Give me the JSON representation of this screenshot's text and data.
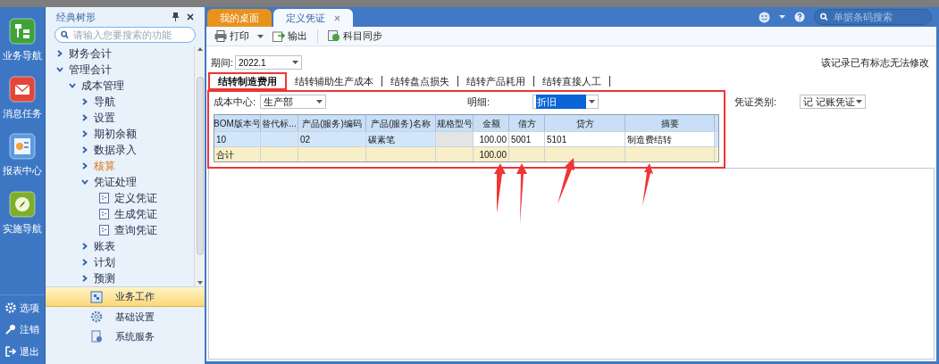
{
  "sidebar": {
    "items": [
      {
        "label": "业务导航",
        "kind": "tree"
      },
      {
        "label": "消息任务",
        "kind": "mail"
      },
      {
        "label": "报表中心",
        "kind": "report"
      },
      {
        "label": "实施导航",
        "kind": "compass"
      }
    ],
    "footer_items": [
      {
        "label": "选项",
        "kind": "gear"
      },
      {
        "label": "注销",
        "kind": "key"
      },
      {
        "label": "退出",
        "kind": "exit"
      }
    ]
  },
  "tree_panel": {
    "title": "经典树形",
    "search": {
      "placeholder": "请输入您要搜索的功能"
    },
    "items": [
      {
        "label": "财务会计",
        "kind": "group",
        "expanded": false,
        "selected": false
      },
      {
        "label": "管理会计",
        "kind": "group",
        "expanded": true,
        "selected": false,
        "children": [
          {
            "label": "成本管理",
            "kind": "group",
            "expanded": true,
            "selected": false,
            "children": [
              {
                "label": "导航",
                "kind": "group",
                "expanded": false,
                "selected": false
              },
              {
                "label": "设置",
                "kind": "group",
                "expanded": false,
                "selected": false
              },
              {
                "label": "期初余额",
                "kind": "group",
                "expanded": false,
                "selected": false
              },
              {
                "label": "数据录入",
                "kind": "group",
                "expanded": false,
                "selected": false
              },
              {
                "label": "核算",
                "kind": "group",
                "expanded": false,
                "selected": true
              },
              {
                "label": "凭证处理",
                "kind": "group",
                "expanded": true,
                "selected": false,
                "children": [
                  {
                    "label": "定义凭证",
                    "kind": "document",
                    "selected": false
                  },
                  {
                    "label": "生成凭证",
                    "kind": "document",
                    "selected": false
                  },
                  {
                    "label": "查询凭证",
                    "kind": "document",
                    "selected": false
                  }
                ]
              },
              {
                "label": "账表",
                "kind": "group",
                "expanded": false,
                "selected": false
              },
              {
                "label": "计划",
                "kind": "group",
                "expanded": false,
                "selected": false
              },
              {
                "label": "预测",
                "kind": "group",
                "expanded": false,
                "selected": false
              }
            ]
          }
        ]
      }
    ],
    "modules": [
      {
        "label": "业务工作",
        "kind": "work",
        "selected": true
      },
      {
        "label": "基础设置",
        "kind": "gear",
        "selected": false
      },
      {
        "label": "系统服务",
        "kind": "service",
        "selected": false
      }
    ]
  },
  "tabs": [
    {
      "label": "我的桌面",
      "selected": false,
      "closable": false
    },
    {
      "label": "定义凭证",
      "selected": true,
      "closable": true
    }
  ],
  "header": {
    "search": {
      "placeholder": "单据条码搜索"
    }
  },
  "toolbar": [
    {
      "label": "打印",
      "kind": "print",
      "dropdown": true
    },
    {
      "label": "输出",
      "kind": "export",
      "dropdown": false
    },
    {
      "label": "科目同步",
      "kind": "sync",
      "dropdown": false
    }
  ],
  "period": {
    "label": "期间:",
    "value": "2022.1"
  },
  "notice": "该记录已有标志无法修改",
  "sub_tabs": [
    {
      "label": "结转制造费用",
      "selected": true
    },
    {
      "label": "结转辅助生产成本",
      "selected": false
    },
    {
      "label": "结转盘点损失",
      "selected": false
    },
    {
      "label": "结转产品耗用",
      "selected": false
    },
    {
      "label": "结转直接人工",
      "selected": false
    }
  ],
  "filters": [
    {
      "label": "成本中心:",
      "value": "生产部",
      "highlighted": false
    },
    {
      "label": "明细:",
      "value": "折旧",
      "highlighted": true
    },
    {
      "label": "凭证类别:",
      "value": "记 记账凭证",
      "highlighted": false
    }
  ],
  "table": {
    "columns": [
      "BOM版本号",
      "替代标...",
      "产品(服务)编码",
      "产品(服务)名称",
      "规格型号",
      "金额",
      "借方",
      "贷方",
      "摘要"
    ],
    "rows": [
      {
        "kind": "data",
        "selected": true,
        "cells": [
          "10",
          "",
          "02",
          "碳素笔",
          "",
          "100.00",
          "5001",
          "5101",
          "制造费结转"
        ]
      },
      {
        "kind": "total",
        "selected": false,
        "cells": [
          "合计",
          "",
          "",
          "",
          "",
          "100.00",
          "",
          "",
          ""
        ]
      }
    ]
  }
}
